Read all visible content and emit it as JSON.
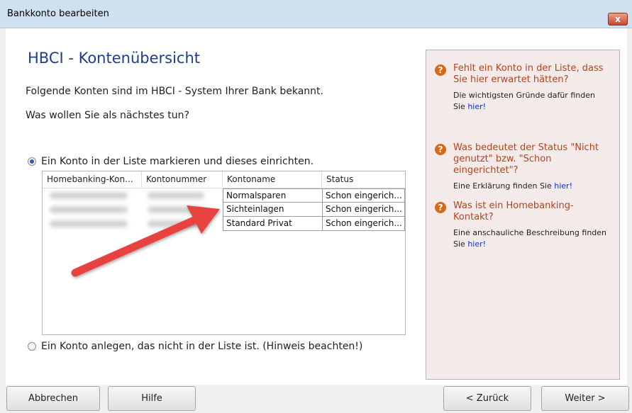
{
  "window": {
    "title": "Bankkonto bearbeiten",
    "close_label": "x"
  },
  "page": {
    "heading": "HBCI - Kontenübersicht",
    "intro": "Folgende Konten sind im HBCI - System Ihrer Bank bekannt.",
    "question": "Was wollen Sie als nächstes tun?"
  },
  "options": [
    {
      "label": "Ein Konto in der Liste markieren und dieses einrichten.",
      "checked": true
    },
    {
      "label": "Ein Konto anlegen, das nicht in der Liste ist. (Hinweis beachten!)",
      "checked": false
    }
  ],
  "table": {
    "headers": [
      "Homebanking-Kon...",
      "Kontonummer",
      "Kontoname",
      "Status"
    ],
    "rows": [
      {
        "kontoname": "Normalsparen",
        "status": "Schon eingerich..."
      },
      {
        "kontoname": "Sichteinlagen",
        "status": "Schon eingerich..."
      },
      {
        "kontoname": "Standard Privat",
        "status": "Schon eingerich..."
      }
    ]
  },
  "help": [
    {
      "question": "Fehlt ein Konto in der Liste, dass Sie hier erwartet hätten?",
      "answer": "Die wichtigsten Gründe dafür finden Sie",
      "link": "hier!"
    },
    {
      "question": "Was bedeutet der Status \"Nicht genutzt\" bzw. \"Schon eingerichtet\"?",
      "answer": "Eine Erklärung finden Sie",
      "link": "hier!"
    },
    {
      "question": "Was ist ein Homebanking-Kontakt?",
      "answer": "Eine anschauliche Beschreibung finden Sie",
      "link": "hier!"
    }
  ],
  "buttons": {
    "cancel": "Abbrechen",
    "help": "Hilfe",
    "back": "< Zurück",
    "next": "Weiter >"
  },
  "colors": {
    "heading": "#1c3e8c",
    "help_question": "#b6431b",
    "help_icon": "#d86a17",
    "sidebar_bg": "#f5eaea",
    "arrow": "#e8423f"
  },
  "icons": {
    "help": "question-circle-icon",
    "close": "close-icon",
    "annotation": "red-arrow-icon"
  }
}
